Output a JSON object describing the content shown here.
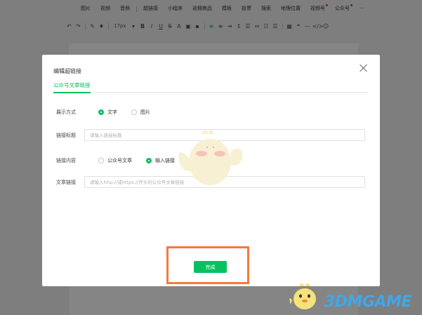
{
  "toolbar": {
    "row1": [
      {
        "label": "图片",
        "dot": false
      },
      {
        "label": "视频",
        "dot": false
      },
      {
        "label": "音频",
        "dot": false
      },
      {
        "label": "超链接",
        "dot": false
      },
      {
        "label": "小程序",
        "dot": false
      },
      {
        "label": "返佣商品",
        "dot": false
      },
      {
        "label": "模板",
        "dot": false
      },
      {
        "label": "投票",
        "dot": false
      },
      {
        "label": "搜索",
        "dot": false
      },
      {
        "label": "地理位置",
        "dot": false
      },
      {
        "label": "视频号",
        "dot": true
      },
      {
        "label": "公众号",
        "dot": true
      }
    ],
    "more_label": "···",
    "font_size": "17px"
  },
  "dialog": {
    "title": "编辑超链接",
    "tab_label": "公众号文章链接",
    "display_mode": {
      "label": "展示方式",
      "options": [
        "文字",
        "图片"
      ],
      "selected": "文字"
    },
    "link_title": {
      "label": "链接标题",
      "placeholder": "请输入链接标题",
      "value": ""
    },
    "link_content": {
      "label": "链接内容",
      "options": [
        "公众号文章",
        "输入链接"
      ],
      "selected": "输入链接"
    },
    "article_link": {
      "label": "文章链接",
      "placeholder": "请输入http://或https://开头的公众号文章链接",
      "value": ""
    },
    "done_label": "完成"
  },
  "watermark": {
    "text": "3DMGAME"
  },
  "colors": {
    "accent": "#07c160",
    "highlight": "#f47a3d",
    "watermark": "#3fa8e8"
  }
}
